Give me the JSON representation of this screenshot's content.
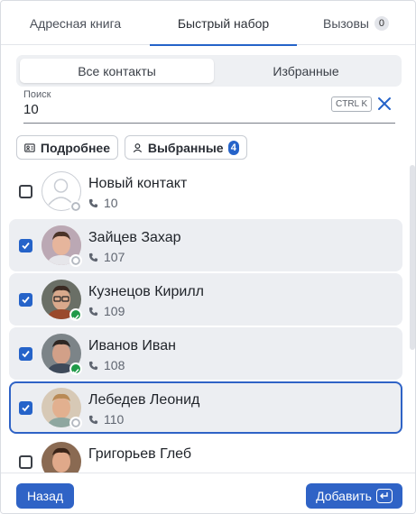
{
  "tabs": [
    {
      "label": "Адресная книга"
    },
    {
      "label": "Быстрый набор"
    },
    {
      "label": "Вызовы",
      "badge": "0"
    }
  ],
  "segment": {
    "all": "Все контакты",
    "favorites": "Избранные"
  },
  "search": {
    "label": "Поиск",
    "value": "10",
    "shortcut": "CTRL K"
  },
  "filters": {
    "details": "Подробнее",
    "selected": "Выбранные",
    "selected_count": "4"
  },
  "contacts": [
    {
      "name": "Новый контакт",
      "ext": "10",
      "checked": false,
      "online": false
    },
    {
      "name": "Зайцев Захар",
      "ext": "107",
      "checked": true,
      "online": false
    },
    {
      "name": "Кузнецов Кирилл",
      "ext": "109",
      "checked": true,
      "online": true
    },
    {
      "name": "Иванов Иван",
      "ext": "108",
      "checked": true,
      "online": true
    },
    {
      "name": "Лебедев Леонид",
      "ext": "110",
      "checked": true,
      "online": false
    },
    {
      "name": "Григорьев Глеб",
      "ext": "",
      "checked": false,
      "online": false
    }
  ],
  "footer": {
    "back": "Назад",
    "add": "Добавить"
  },
  "colors": {
    "accent": "#2563c9",
    "online": "#1f9a48",
    "selected_row": "#eceef2"
  }
}
